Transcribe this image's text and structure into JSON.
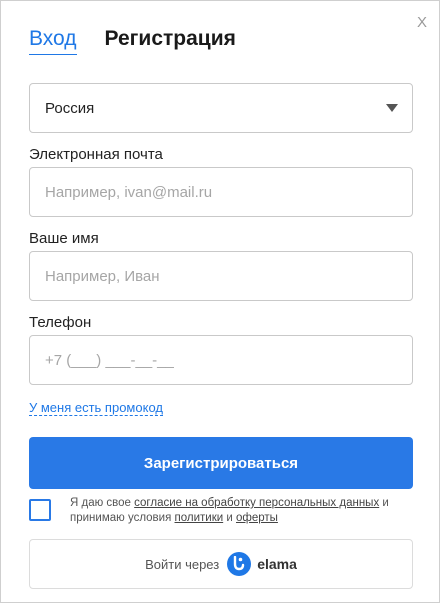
{
  "close_label": "X",
  "tabs": {
    "login": "Вход",
    "register": "Регистрация"
  },
  "country": {
    "selected": "Россия"
  },
  "email": {
    "label": "Электронная почта",
    "placeholder": "Например, ivan@mail.ru"
  },
  "name": {
    "label": "Ваше имя",
    "placeholder": "Например, Иван"
  },
  "phone": {
    "label": "Телефон",
    "placeholder": "+7 (___) ___-__-__"
  },
  "promo_link": "У меня есть промокод",
  "submit_label": "Зарегистрироваться",
  "consent": {
    "part1": "Я даю свое ",
    "link_consent": "согласие на обработку персональных данных",
    "part2": " и принимаю условия ",
    "link_policy": "политики",
    "part3": " и ",
    "link_offer": "оферты"
  },
  "elama_button": {
    "prefix": "Войти через",
    "brand": "elama"
  },
  "colors": {
    "accent": "#2979e6",
    "link": "#1f78e6"
  }
}
